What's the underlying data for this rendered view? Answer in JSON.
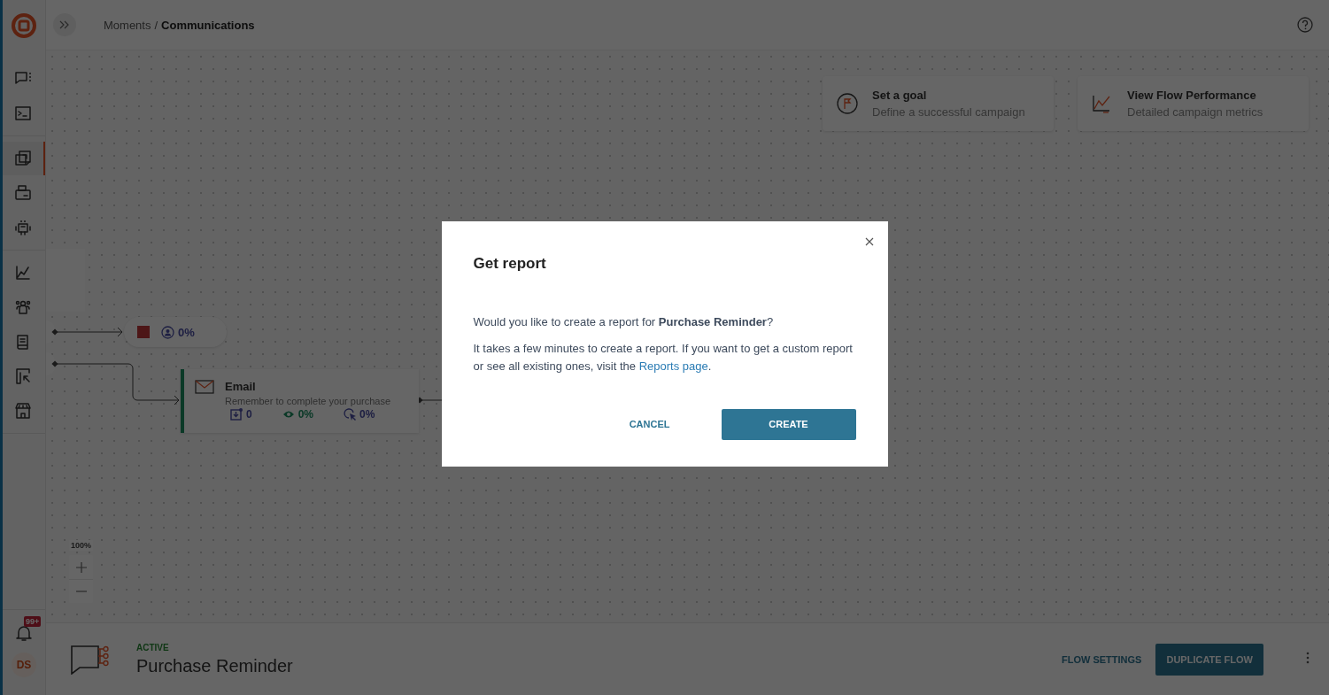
{
  "header": {
    "breadcrumb_parent": "Moments",
    "breadcrumb_separator": "/",
    "breadcrumb_current": "Communications"
  },
  "sidebar": {
    "groups": [
      {
        "items": [
          {
            "kind": "chat",
            "selected": false
          },
          {
            "kind": "terminal",
            "selected": false
          }
        ]
      },
      {
        "items": [
          {
            "kind": "flows",
            "selected": true
          },
          {
            "kind": "broadcast",
            "selected": false
          },
          {
            "kind": "bot",
            "selected": false
          }
        ]
      },
      {
        "items": [
          {
            "kind": "analytics",
            "selected": false
          },
          {
            "kind": "people",
            "selected": false
          },
          {
            "kind": "book",
            "selected": false
          },
          {
            "kind": "export",
            "selected": false
          },
          {
            "kind": "store",
            "selected": false
          }
        ]
      }
    ],
    "notification_badge": "99+",
    "avatar_initials": "DS"
  },
  "canvas": {
    "cards": [
      {
        "kind": "goal",
        "title": "Set a goal",
        "subtitle": "Define a successful campaign"
      },
      {
        "kind": "performance",
        "title": "View Flow Performance",
        "subtitle": "Detailed campaign metrics"
      }
    ],
    "exit_node": {
      "percent": "0%"
    },
    "email_node": {
      "title": "Email",
      "description": "Remember to complete your purchase",
      "stats": [
        {
          "kind": "sent",
          "value": "0"
        },
        {
          "kind": "opened",
          "value": "0%"
        },
        {
          "kind": "clicked",
          "value": "0%"
        }
      ]
    },
    "zoom_label": "100%"
  },
  "flow_bar": {
    "status": "ACTIVE",
    "name": "Purchase Reminder",
    "actions": [
      {
        "kind": "text",
        "label": "FLOW SETTINGS"
      },
      {
        "kind": "primary",
        "label": "DUPLICATE FLOW"
      }
    ]
  },
  "dialog": {
    "title": "Get report",
    "question": "Would you like to create a report for **Purchase Reminder**?",
    "info": "It takes a few minutes to create a report. If you want to get a custom report or see all existing ones, visit the ",
    "link": "Reports page",
    "info_end": ".",
    "buttons": [
      {
        "kind": "text",
        "label": "CANCEL"
      },
      {
        "kind": "primary",
        "label": "CREATE"
      }
    ]
  }
}
